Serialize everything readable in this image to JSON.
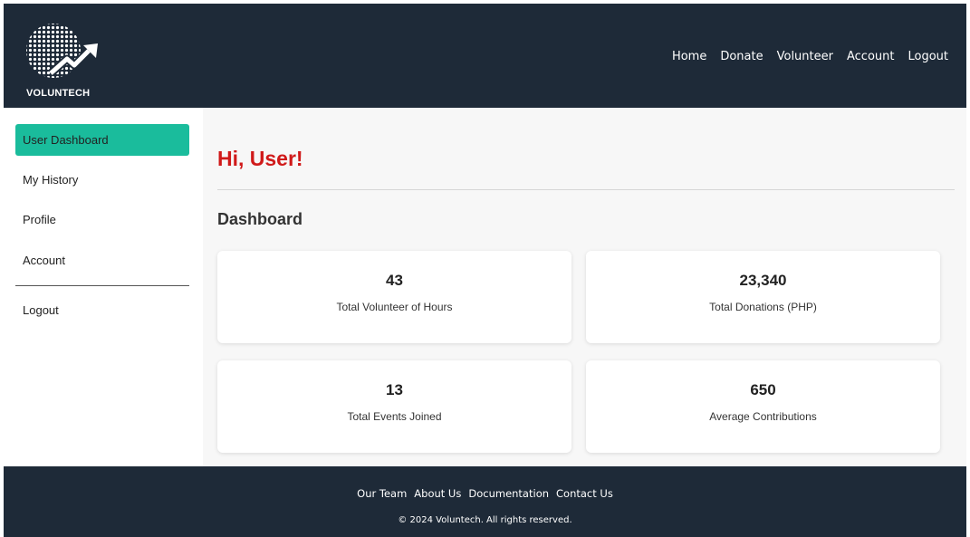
{
  "header": {
    "logo_text": "VOLUNTECH",
    "nav": [
      "Home",
      "Donate",
      "Volunteer",
      "Account",
      "Logout"
    ]
  },
  "sidebar": {
    "items": [
      {
        "label": "User Dashboard",
        "active": true
      },
      {
        "label": "My History",
        "active": false
      },
      {
        "label": "Profile",
        "active": false
      },
      {
        "label": "Account",
        "active": false
      },
      {
        "label": "Logout",
        "active": false
      }
    ]
  },
  "main": {
    "greeting": "Hi, User!",
    "section_title": "Dashboard",
    "cards": [
      {
        "value": "43",
        "label": "Total Volunteer of Hours"
      },
      {
        "value": "23,340",
        "label": "Total Donations (PHP)"
      },
      {
        "value": "13",
        "label": "Total Events Joined"
      },
      {
        "value": "650",
        "label": "Average Contributions"
      }
    ]
  },
  "footer": {
    "links": [
      "Our Team",
      "About Us",
      "Documentation",
      "Contact Us"
    ],
    "copyright": "© 2024 Voluntech. All rights reserved."
  },
  "colors": {
    "navbar": "#1e2a38",
    "active_item": "#1abc9c",
    "greeting": "#d01a1a"
  },
  "icons": {
    "logo": "globe-with-rising-arrow-icon"
  }
}
